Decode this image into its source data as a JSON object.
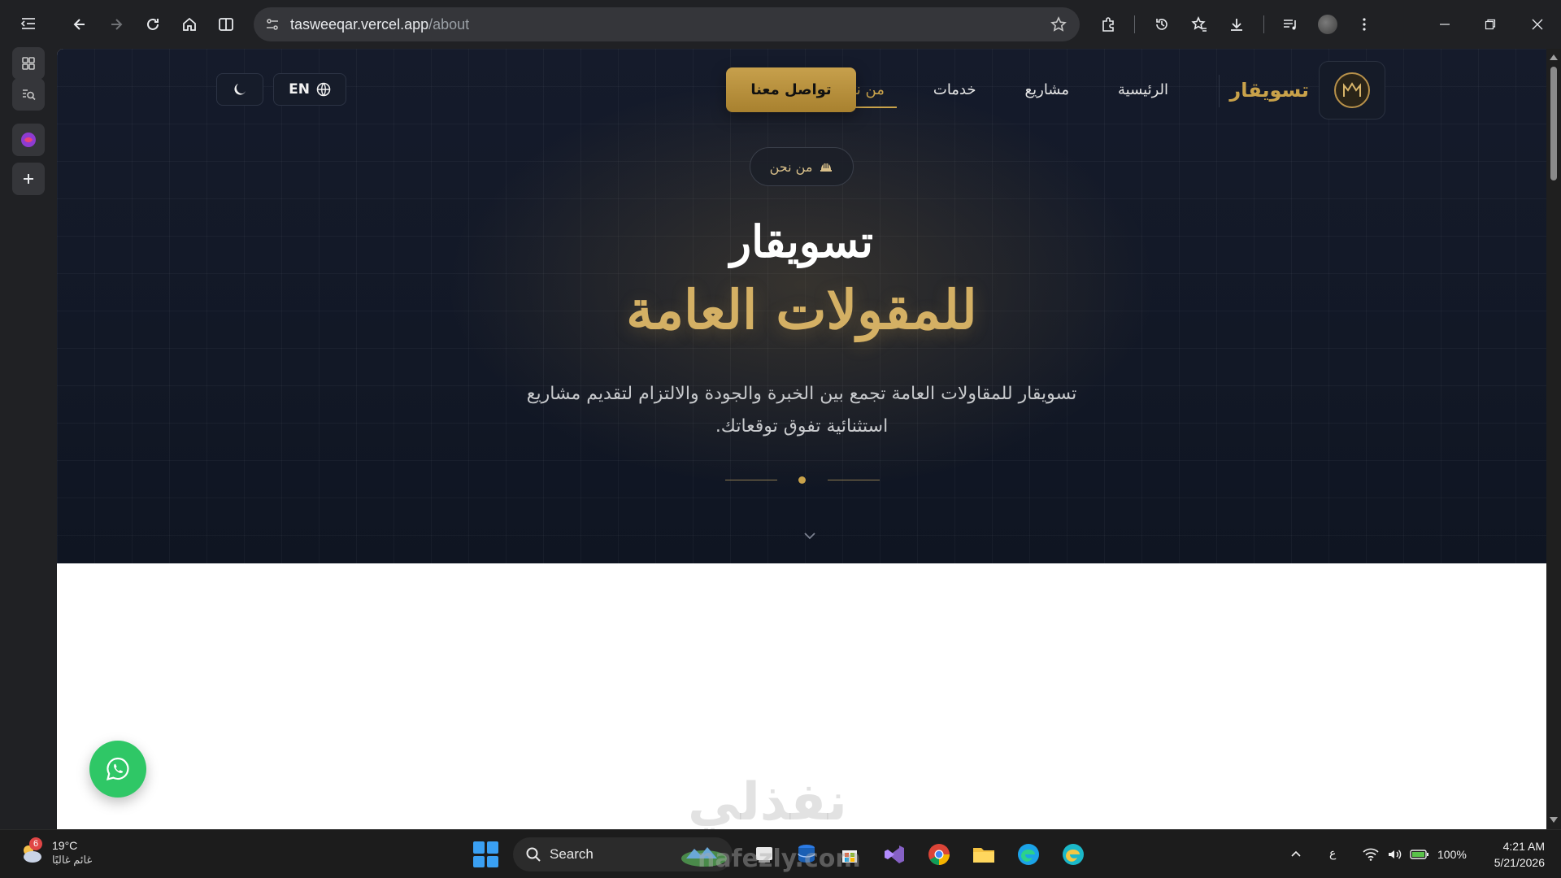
{
  "browser": {
    "url_host": "tasweeqar.vercel.app",
    "url_path": "/about"
  },
  "site": {
    "brand_name": "تسويقار",
    "nav": {
      "items": [
        "الرئيسية",
        "مشاريع",
        "خدمات",
        "من نحن"
      ],
      "active_index": 3,
      "cta_label": "تواصل معنا",
      "lang_label": "EN"
    },
    "hero": {
      "badge_label": "من نحن",
      "title_line1": "تسويقار",
      "title_line2": "للمقولات العامة",
      "description": "تسويقار للمقاولات العامة تجمع بين الخبرة والجودة والالتزام لتقديم مشاريع استثنائية تفوق توقعاتك."
    },
    "watermark": "نفذلي",
    "colors": {
      "gold": "#c9a24a",
      "navy": "#131a28",
      "whatsapp": "#2fc766"
    }
  },
  "taskbar": {
    "weather": {
      "temp": "19°C",
      "condition": "غائم غالبًا",
      "alert_count": "6"
    },
    "search_label": "Search",
    "watermark_url": "nafezly.com",
    "tray": {
      "keyboard": "ع",
      "battery": "100%"
    },
    "clock": {
      "time": "4:21 AM",
      "date": "5/21/2026"
    }
  }
}
